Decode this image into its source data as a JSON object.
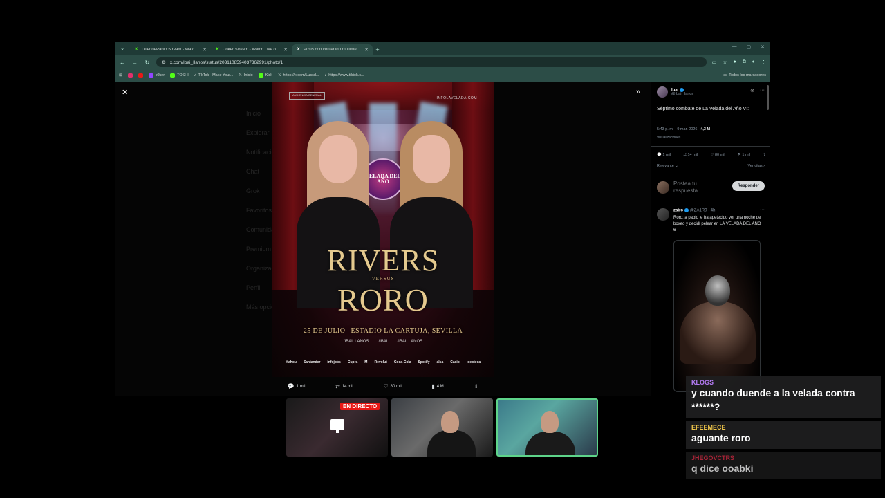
{
  "browser": {
    "tabs": [
      {
        "icon": "K",
        "icon_color": "#53fc18",
        "title": "DuendePablo Stream - Watch L",
        "active": false
      },
      {
        "icon": "K",
        "icon_color": "#53fc18",
        "title": "Coker Stream - Watch Live on K",
        "active": false
      },
      {
        "icon": "X",
        "icon_color": "#ffffff",
        "title": "Posts con contenido multimedia",
        "active": true
      }
    ],
    "url": "x.com/Ibai_Ilanos/status/2031108594037362991/photo/1",
    "bookmarks": [
      {
        "label": "",
        "color": "#e1306c"
      },
      {
        "label": "",
        "color": "#e91916"
      },
      {
        "label": "c0ker",
        "color": "#9146ff"
      },
      {
        "label": "TOSHI",
        "color": "#53fc18"
      },
      {
        "label": "TikTok - Make Your...",
        "color": "#222222"
      },
      {
        "label": "Inicio",
        "color": "#ffffff"
      },
      {
        "label": "Kick",
        "color": "#53fc18"
      },
      {
        "label": "https://x.com/Lucsd...",
        "color": "#ffffff"
      },
      {
        "label": "https://www.tiktok.c...",
        "color": "#222222"
      }
    ],
    "bookmarks_all": "Todos los marcadores"
  },
  "poster": {
    "top_left": "AUDIENCIA GENERAL",
    "top_right": "INFOLAVELADA.COM",
    "logo": "VELADA DEL AÑO",
    "fighter1": "RIVERS",
    "versus": "VERSUS",
    "fighter2": "RORO",
    "date_place": "25 DE JULIO | ESTADIO LA CARTUJA, SEVILLA",
    "socials": [
      "/IBAILLANOS",
      "/IBAI",
      "/IBAILLANOS"
    ],
    "sponsors": [
      "Mahou",
      "Santander",
      "infojobs",
      "Cupra",
      "M",
      "Revolut",
      "Coca-Cola",
      "Spotify",
      "alsa",
      "Casio",
      "Ideoteca"
    ]
  },
  "media_actions": {
    "replies": "1 mil",
    "reposts": "14 mil",
    "likes": "80 mil",
    "views": "4 M"
  },
  "tweet": {
    "name": "Ibai",
    "handle": "@Ibai_Ilanos",
    "text": "Séptimo combate de La Velada del Año VI:",
    "time": "5:43 p. m. · 9 mar. 2026 ·",
    "views": "4,3 M",
    "views_label": "Visualizaciones",
    "stats": [
      "1 mil",
      "14 mil",
      "80 mil",
      "1 mil"
    ],
    "relevance": "Relevante",
    "quotes": "Ver citas",
    "reply_placeholder": "Postea tu respuesta",
    "reply_button": "Responder"
  },
  "reply": {
    "name": "zairo",
    "handle": "@ZA1R0 · 4h",
    "text": "Roro: a pablo le ha apetecido ver una noche de boxeo y decidí pelear en LA VELADA DEL AÑO 6"
  },
  "background_nav": [
    "Inicio",
    "Explorar",
    "Notificaciones",
    "Chat",
    "Grok",
    "Favoritos",
    "Comunidades",
    "Premium",
    "Organizaciones",
    "Perfil",
    "Más opciones"
  ],
  "stream": {
    "live_label": "EN DIRECTO"
  },
  "chat": [
    {
      "user": "KLOGS",
      "color": "#b57cf5",
      "text": "y cuando duende a la velada contra ******?"
    },
    {
      "user": "EFEEMECE",
      "color": "#f0c64a",
      "text": "aguante roro"
    },
    {
      "user": "JHEGOVCTRS",
      "color": "#e0304a",
      "text": "q dice ooabki"
    }
  ]
}
